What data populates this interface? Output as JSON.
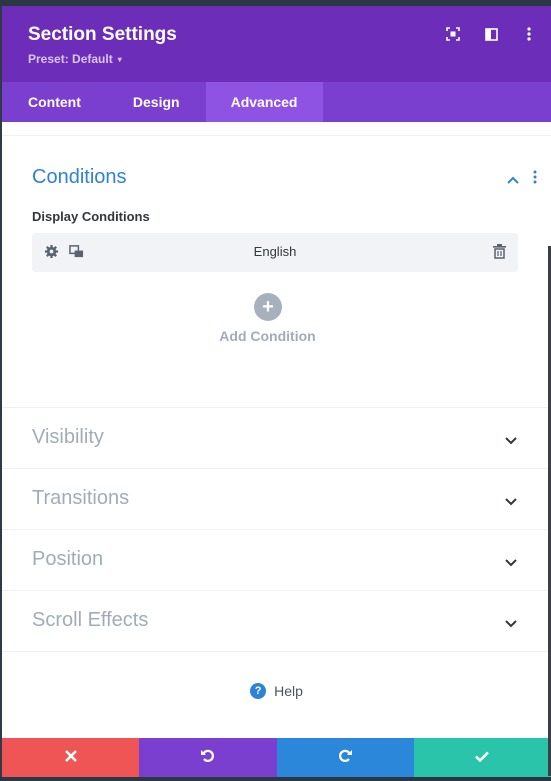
{
  "header": {
    "title": "Section Settings",
    "preset": "Preset: Default",
    "caret": "▾",
    "icons": [
      "expand-icon",
      "sidebar-layout-icon",
      "more-vertical-icon"
    ]
  },
  "tabs": [
    {
      "label": "Content",
      "active": false
    },
    {
      "label": "Design",
      "active": false
    },
    {
      "label": "Advanced",
      "active": true
    }
  ],
  "conditions": {
    "title": "Conditions",
    "display_label": "Display Conditions",
    "item": "English",
    "add_label": "Add Condition"
  },
  "sections": [
    {
      "label": "Visibility"
    },
    {
      "label": "Transitions"
    },
    {
      "label": "Position"
    },
    {
      "label": "Scroll Effects"
    }
  ],
  "help": {
    "label": "Help",
    "icon": "?"
  },
  "footer": {
    "buttons": [
      {
        "name": "discard",
        "color": "#ef5555"
      },
      {
        "name": "undo",
        "color": "#7b3fd0"
      },
      {
        "name": "redo",
        "color": "#2b87da"
      },
      {
        "name": "save",
        "color": "#29c4a9"
      }
    ]
  },
  "colors": {
    "header": "#6c2eb9",
    "tabs": "#7b3fd0",
    "active_tab": "#8f53e4",
    "accent_blue": "#2e82d6",
    "muted_text": "#a2acb8"
  }
}
